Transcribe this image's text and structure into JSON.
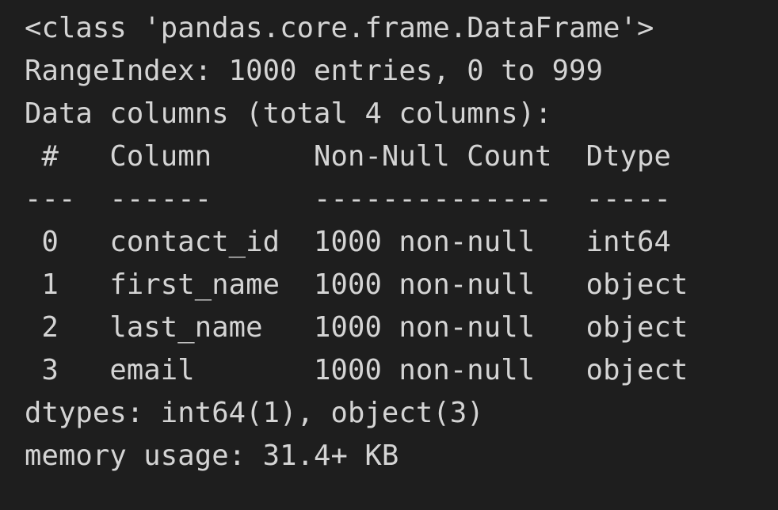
{
  "output": {
    "class_line": "<class 'pandas.core.frame.DataFrame'>",
    "index_line": "RangeIndex: 1000 entries, 0 to 999",
    "columns_summary": "Data columns (total 4 columns):",
    "table_header": " #   Column      Non-Null Count  Dtype ",
    "table_separator": "---  ------      --------------  ----- ",
    "rows": [
      " 0   contact_id  1000 non-null   int64 ",
      " 1   first_name  1000 non-null   object",
      " 2   last_name   1000 non-null   object",
      " 3   email       1000 non-null   object"
    ],
    "dtypes_line": "dtypes: int64(1), object(3)",
    "memory_line": "memory usage: 31.4+ KB"
  },
  "colors": {
    "background": "#1e1e1e",
    "text": "#d4d4d4"
  }
}
